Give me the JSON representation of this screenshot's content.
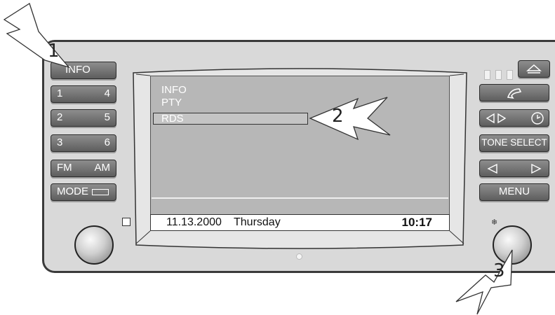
{
  "left_buttons": [
    {
      "name": "info-button",
      "left": "INFO",
      "right": ""
    },
    {
      "name": "preset-1-4-button",
      "left": "1",
      "right": "4"
    },
    {
      "name": "preset-2-5-button",
      "left": "2",
      "right": "5"
    },
    {
      "name": "preset-3-6-button",
      "left": "3",
      "right": "6"
    },
    {
      "name": "band-button",
      "left": "FM",
      "right": "AM"
    },
    {
      "name": "mode-button",
      "left": "MODE",
      "right": ""
    }
  ],
  "right_buttons": {
    "tone_select": "TONE SELECT",
    "menu": "MENU",
    "eject_icon": "eject-icon",
    "phone_icon": "phone-icon",
    "clock_icon": "clock-icon"
  },
  "display": {
    "menu_items": [
      "INFO",
      "PTY",
      "RDS"
    ],
    "selected": "RDS",
    "date": "11.13.2000",
    "day": "Thursday",
    "time": "10:17"
  },
  "callouts": [
    "1",
    "2",
    "3"
  ],
  "colors": {
    "button": "#6e6e6e",
    "panel": "#d9d9d9",
    "screen": "#b7b7b7"
  }
}
